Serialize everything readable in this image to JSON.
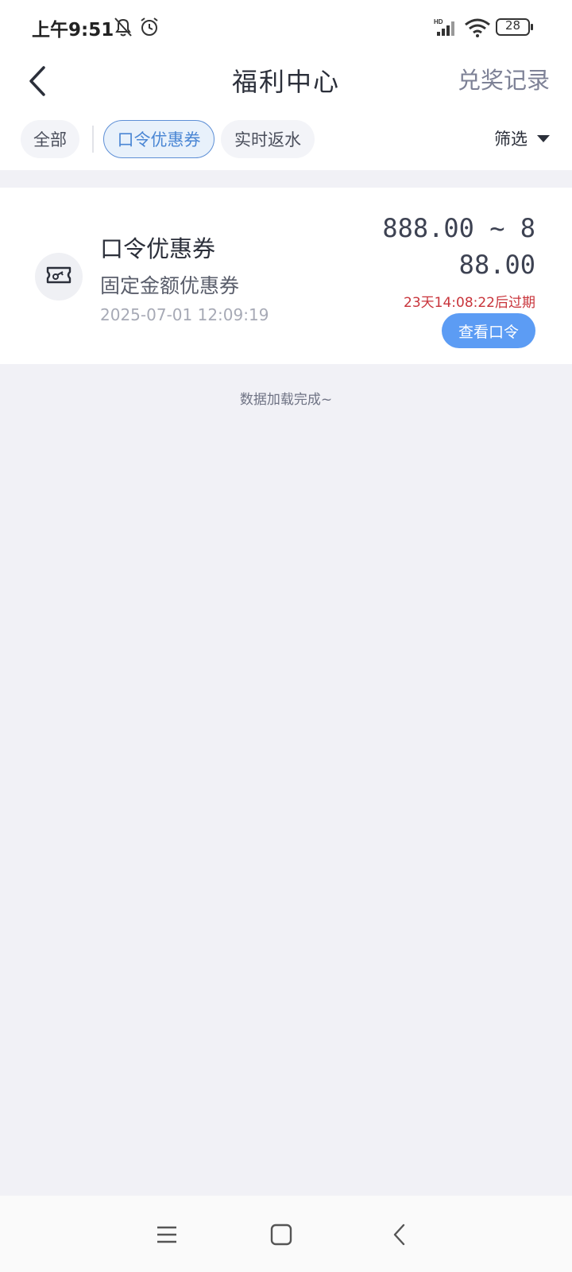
{
  "status_bar": {
    "time": "上午9:51",
    "battery": "28"
  },
  "header": {
    "title": "福利中心",
    "records_label": "兑奖记录"
  },
  "tabs": [
    {
      "label": "全部",
      "active": false
    },
    {
      "label": "口令优惠券",
      "active": true
    },
    {
      "label": "实时返水",
      "active": false
    }
  ],
  "filter": {
    "label": "筛选"
  },
  "coupon": {
    "title": "口令优惠券",
    "subtitle": "固定金额优惠券",
    "date": "2025-07-01 12:09:19",
    "amount": "888.00 ~ 888.00",
    "expiry": "23天14:08:22后过期",
    "action_label": "查看口令"
  },
  "list_footer": "数据加载完成~",
  "colors": {
    "accent": "#5c9cf4",
    "expiry": "#c8333a",
    "background": "#f1f1f6"
  }
}
